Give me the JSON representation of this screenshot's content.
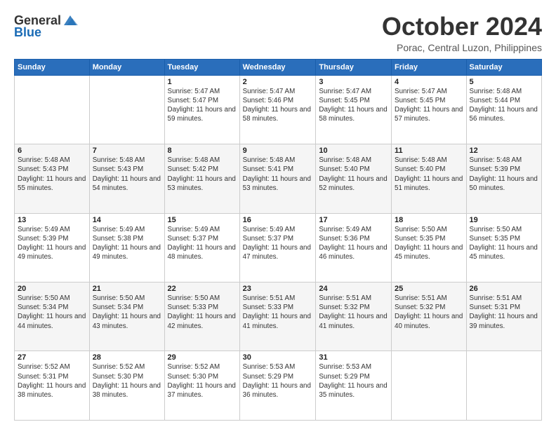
{
  "header": {
    "logo_general": "General",
    "logo_blue": "Blue",
    "month_title": "October 2024",
    "location": "Porac, Central Luzon, Philippines"
  },
  "days_of_week": [
    "Sunday",
    "Monday",
    "Tuesday",
    "Wednesday",
    "Thursday",
    "Friday",
    "Saturday"
  ],
  "weeks": [
    [
      {
        "day": "",
        "info": ""
      },
      {
        "day": "",
        "info": ""
      },
      {
        "day": "1",
        "info": "Sunrise: 5:47 AM\nSunset: 5:47 PM\nDaylight: 11 hours and 59 minutes."
      },
      {
        "day": "2",
        "info": "Sunrise: 5:47 AM\nSunset: 5:46 PM\nDaylight: 11 hours and 58 minutes."
      },
      {
        "day": "3",
        "info": "Sunrise: 5:47 AM\nSunset: 5:45 PM\nDaylight: 11 hours and 58 minutes."
      },
      {
        "day": "4",
        "info": "Sunrise: 5:47 AM\nSunset: 5:45 PM\nDaylight: 11 hours and 57 minutes."
      },
      {
        "day": "5",
        "info": "Sunrise: 5:48 AM\nSunset: 5:44 PM\nDaylight: 11 hours and 56 minutes."
      }
    ],
    [
      {
        "day": "6",
        "info": "Sunrise: 5:48 AM\nSunset: 5:43 PM\nDaylight: 11 hours and 55 minutes."
      },
      {
        "day": "7",
        "info": "Sunrise: 5:48 AM\nSunset: 5:43 PM\nDaylight: 11 hours and 54 minutes."
      },
      {
        "day": "8",
        "info": "Sunrise: 5:48 AM\nSunset: 5:42 PM\nDaylight: 11 hours and 53 minutes."
      },
      {
        "day": "9",
        "info": "Sunrise: 5:48 AM\nSunset: 5:41 PM\nDaylight: 11 hours and 53 minutes."
      },
      {
        "day": "10",
        "info": "Sunrise: 5:48 AM\nSunset: 5:40 PM\nDaylight: 11 hours and 52 minutes."
      },
      {
        "day": "11",
        "info": "Sunrise: 5:48 AM\nSunset: 5:40 PM\nDaylight: 11 hours and 51 minutes."
      },
      {
        "day": "12",
        "info": "Sunrise: 5:48 AM\nSunset: 5:39 PM\nDaylight: 11 hours and 50 minutes."
      }
    ],
    [
      {
        "day": "13",
        "info": "Sunrise: 5:49 AM\nSunset: 5:39 PM\nDaylight: 11 hours and 49 minutes."
      },
      {
        "day": "14",
        "info": "Sunrise: 5:49 AM\nSunset: 5:38 PM\nDaylight: 11 hours and 49 minutes."
      },
      {
        "day": "15",
        "info": "Sunrise: 5:49 AM\nSunset: 5:37 PM\nDaylight: 11 hours and 48 minutes."
      },
      {
        "day": "16",
        "info": "Sunrise: 5:49 AM\nSunset: 5:37 PM\nDaylight: 11 hours and 47 minutes."
      },
      {
        "day": "17",
        "info": "Sunrise: 5:49 AM\nSunset: 5:36 PM\nDaylight: 11 hours and 46 minutes."
      },
      {
        "day": "18",
        "info": "Sunrise: 5:50 AM\nSunset: 5:35 PM\nDaylight: 11 hours and 45 minutes."
      },
      {
        "day": "19",
        "info": "Sunrise: 5:50 AM\nSunset: 5:35 PM\nDaylight: 11 hours and 45 minutes."
      }
    ],
    [
      {
        "day": "20",
        "info": "Sunrise: 5:50 AM\nSunset: 5:34 PM\nDaylight: 11 hours and 44 minutes."
      },
      {
        "day": "21",
        "info": "Sunrise: 5:50 AM\nSunset: 5:34 PM\nDaylight: 11 hours and 43 minutes."
      },
      {
        "day": "22",
        "info": "Sunrise: 5:50 AM\nSunset: 5:33 PM\nDaylight: 11 hours and 42 minutes."
      },
      {
        "day": "23",
        "info": "Sunrise: 5:51 AM\nSunset: 5:33 PM\nDaylight: 11 hours and 41 minutes."
      },
      {
        "day": "24",
        "info": "Sunrise: 5:51 AM\nSunset: 5:32 PM\nDaylight: 11 hours and 41 minutes."
      },
      {
        "day": "25",
        "info": "Sunrise: 5:51 AM\nSunset: 5:32 PM\nDaylight: 11 hours and 40 minutes."
      },
      {
        "day": "26",
        "info": "Sunrise: 5:51 AM\nSunset: 5:31 PM\nDaylight: 11 hours and 39 minutes."
      }
    ],
    [
      {
        "day": "27",
        "info": "Sunrise: 5:52 AM\nSunset: 5:31 PM\nDaylight: 11 hours and 38 minutes."
      },
      {
        "day": "28",
        "info": "Sunrise: 5:52 AM\nSunset: 5:30 PM\nDaylight: 11 hours and 38 minutes."
      },
      {
        "day": "29",
        "info": "Sunrise: 5:52 AM\nSunset: 5:30 PM\nDaylight: 11 hours and 37 minutes."
      },
      {
        "day": "30",
        "info": "Sunrise: 5:53 AM\nSunset: 5:29 PM\nDaylight: 11 hours and 36 minutes."
      },
      {
        "day": "31",
        "info": "Sunrise: 5:53 AM\nSunset: 5:29 PM\nDaylight: 11 hours and 35 minutes."
      },
      {
        "day": "",
        "info": ""
      },
      {
        "day": "",
        "info": ""
      }
    ]
  ]
}
